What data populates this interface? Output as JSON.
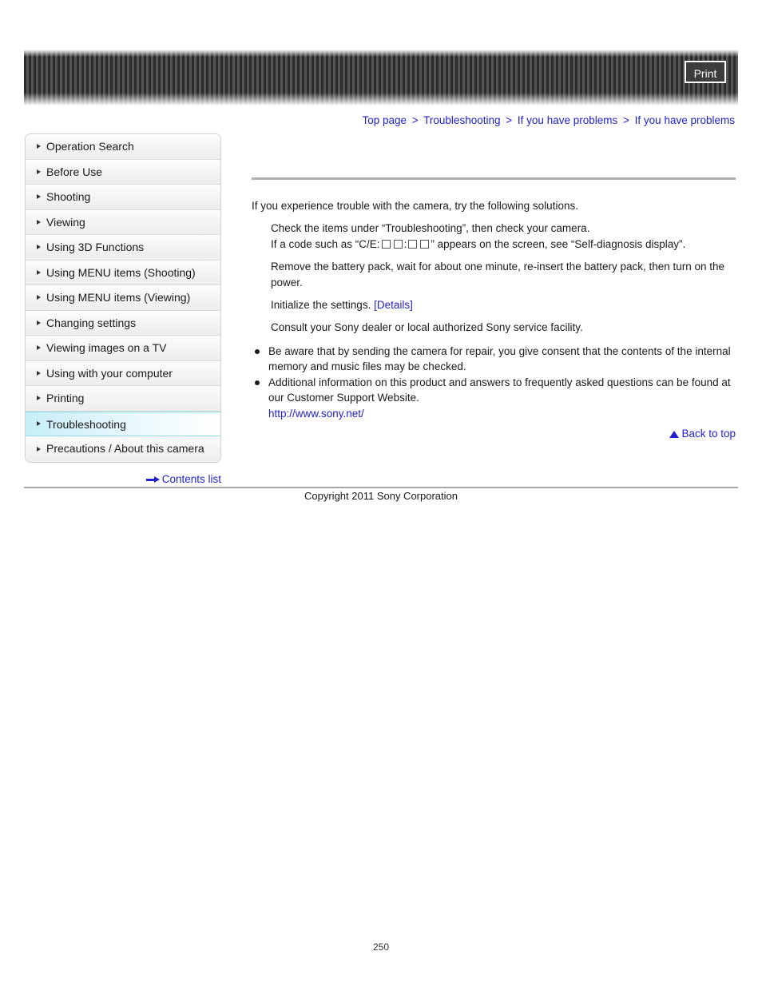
{
  "header": {
    "print_label": "Print"
  },
  "breadcrumb": {
    "separator": ">",
    "items": [
      {
        "label": "Top page"
      },
      {
        "label": "Troubleshooting"
      },
      {
        "label": "If you have problems"
      },
      {
        "label": "If you have problems"
      }
    ]
  },
  "sidebar": {
    "items": [
      {
        "label": "Operation Search",
        "active": false
      },
      {
        "label": "Before Use",
        "active": false
      },
      {
        "label": "Shooting",
        "active": false
      },
      {
        "label": "Viewing",
        "active": false
      },
      {
        "label": "Using 3D Functions",
        "active": false
      },
      {
        "label": "Using MENU items (Shooting)",
        "active": false
      },
      {
        "label": "Using MENU items (Viewing)",
        "active": false
      },
      {
        "label": "Changing settings",
        "active": false
      },
      {
        "label": "Viewing images on a TV",
        "active": false
      },
      {
        "label": "Using with your computer",
        "active": false
      },
      {
        "label": "Printing",
        "active": false
      },
      {
        "label": "Troubleshooting",
        "active": true
      },
      {
        "label": "Precautions / About this camera",
        "active": false
      }
    ],
    "contents_list_label": "Contents list"
  },
  "main": {
    "intro": "If you experience trouble with the camera, try the following solutions.",
    "step1": "Check the items under “Troubleshooting”, then check your camera.",
    "step2_prefix": "If a code such as “C/E:",
    "step2_mid": ":",
    "step2_suffix": "” appears on the screen, see “Self-diagnosis display”.",
    "step3": "Remove the battery pack, wait for about one minute, re-insert the battery pack, then turn on the power.",
    "step4_text": "Initialize the settings.",
    "step4_link": "[Details]",
    "step5": "Consult your Sony dealer or local authorized Sony service facility.",
    "bullet1": "Be aware that by sending the camera for repair, you give consent that the contents of the internal memory and music files may be checked.",
    "bullet2": "Additional information on this product and answers to frequently asked questions can be found at our Customer Support Website.",
    "bullet2_url": "http://www.sony.net/",
    "back_to_top": "Back to top"
  },
  "footer": {
    "copyright": "Copyright 2011 Sony Corporation",
    "page_number": "250"
  },
  "colors": {
    "link": "#2222cc",
    "active_nav": "#c7eef8",
    "rule": "#b0b0b0",
    "banner": "#3a3a3a"
  }
}
